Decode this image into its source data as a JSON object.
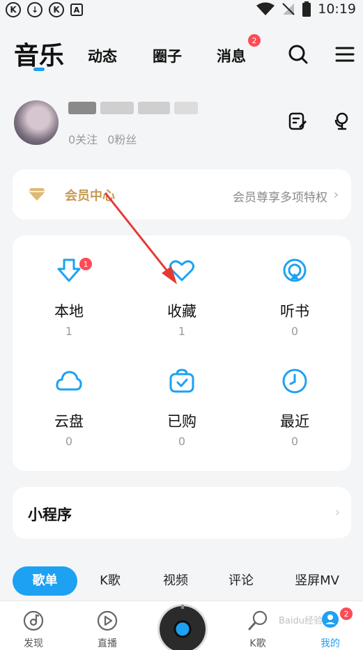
{
  "status_bar": {
    "left_icons": [
      "K",
      "↓",
      "K",
      "A"
    ],
    "time": "10:19"
  },
  "top_nav": {
    "tabs": [
      {
        "label": "音乐",
        "active": true
      },
      {
        "label": "动态"
      },
      {
        "label": "圈子"
      },
      {
        "label": "消息",
        "badge": "2"
      }
    ],
    "icons": [
      "search-icon",
      "menu-icon"
    ]
  },
  "profile": {
    "following": "0关注",
    "fans": "0粉丝",
    "icons": [
      "edit-icon",
      "mic-icon"
    ]
  },
  "vip": {
    "title": "会员中心",
    "subtitle": "会员尊享多项特权",
    "chevron": "›"
  },
  "library": [
    {
      "label": "本地",
      "count": "1",
      "icon": "download-icon",
      "badge": "1"
    },
    {
      "label": "收藏",
      "count": "1",
      "icon": "heart-icon"
    },
    {
      "label": "听书",
      "count": "0",
      "icon": "audiobook-icon"
    },
    {
      "label": "云盘",
      "count": "0",
      "icon": "cloud-icon"
    },
    {
      "label": "已购",
      "count": "0",
      "icon": "purchased-icon"
    },
    {
      "label": "最近",
      "count": "0",
      "icon": "clock-icon"
    }
  ],
  "mini_programs": {
    "title": "小程序",
    "chevron": "›"
  },
  "pills": [
    "歌单",
    "K歌",
    "视频",
    "评论",
    "竖屏MV"
  ],
  "bottom_nav": [
    {
      "label": "发现",
      "icon": "discover-icon"
    },
    {
      "label": "直播",
      "icon": "live-icon"
    },
    {
      "label": "",
      "icon": "player-disc-icon"
    },
    {
      "label": "K歌",
      "icon": "karaoke-icon"
    },
    {
      "label": "我的",
      "icon": "profile-icon",
      "active": true,
      "badge": "2"
    }
  ],
  "watermark": "Baidu经验",
  "colors": {
    "accent": "#1da1f2",
    "vip_gold": "#c49a52",
    "badge": "#ff4b55",
    "arrow": "#e53935"
  }
}
